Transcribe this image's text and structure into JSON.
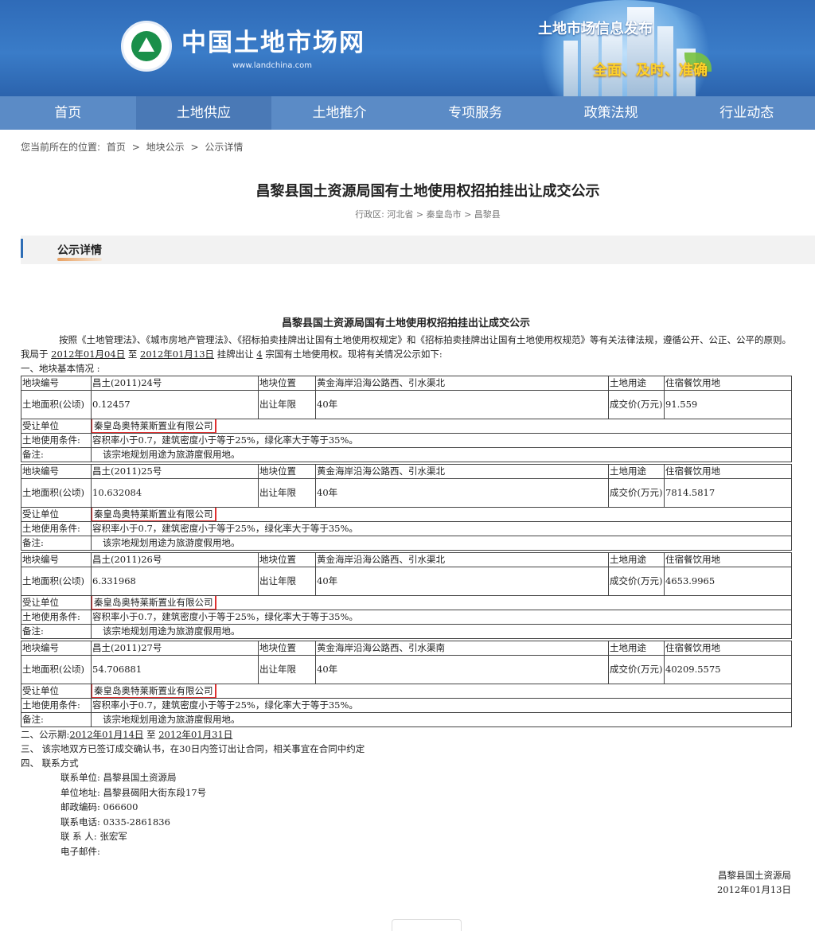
{
  "header": {
    "site_name": "中国土地市场网",
    "site_url": "www.landchina.com",
    "banner_title": "土地市场信息发布",
    "banner_slogan": "全面、及时、准确"
  },
  "nav": [
    "首页",
    "土地供应",
    "土地推介",
    "专项服务",
    "政策法规",
    "行业动态"
  ],
  "breadcrumb": {
    "prefix": "您当前所在的位置:",
    "items": [
      "首页",
      ">",
      "地块公示",
      ">",
      "公示详情"
    ]
  },
  "page_title": "昌黎县国土资源局国有土地使用权招拍挂出让成交公示",
  "region": "行政区: 河北省 > 秦皇岛市 > 昌黎县",
  "section_title": "公示详情",
  "doc": {
    "title": "昌黎县国土资源局国有土地使用权招拍挂出让成交公示",
    "intro_a": "按照《土地管理法》、《城市房地产管理法》、《招标拍卖挂牌出让国有土地使用权规定》和《招标拍卖挂牌出让国有土地使用权规范》等有关法律法规，遵循公开、公正、公平的原则。我局于",
    "date_start": "2012年01月04日",
    "to": "至",
    "date_end": "2012年01月13日",
    "intro_b": "挂牌出让",
    "count": "4",
    "intro_c": "宗国有土地使用权。现将有关情况公示如下:",
    "section1": "一、地块基本情况 :",
    "labels": {
      "id": "地块编号",
      "location": "地块位置",
      "use": "土地用途",
      "area": "土地面积(公顷)",
      "term": "出让年限",
      "price": "成交价(万元)",
      "winner": "受让单位",
      "conditions": "土地使用条件:",
      "remark": "备注:"
    },
    "plots": [
      {
        "id": "昌土(2011)24号",
        "location": "黄金海岸沿海公路西、引水渠北",
        "use": "住宿餐饮用地",
        "area": "0.12457",
        "term": "40年",
        "price": "91.559",
        "winner": "秦皇岛奥特莱斯置业有限公司",
        "conditions": "容积率小于0.7，建筑密度小于等于25%，绿化率大于等于35%。",
        "remark": "该宗地规划用途为旅游度假用地。"
      },
      {
        "id": "昌土(2011)25号",
        "location": "黄金海岸沿海公路西、引水渠北",
        "use": "住宿餐饮用地",
        "area": "10.632084",
        "term": "40年",
        "price": "7814.5817",
        "winner": "秦皇岛奥特莱斯置业有限公司",
        "conditions": "容积率小于0.7，建筑密度小于等于25%，绿化率大于等于35%。",
        "remark": "该宗地规划用途为旅游度假用地。"
      },
      {
        "id": "昌土(2011)26号",
        "location": "黄金海岸沿海公路西、引水渠北",
        "use": "住宿餐饮用地",
        "area": "6.331968",
        "term": "40年",
        "price": "4653.9965",
        "winner": "秦皇岛奥特莱斯置业有限公司",
        "conditions": "容积率小于0.7，建筑密度小于等于25%，绿化率大于等于35%。",
        "remark": "该宗地规划用途为旅游度假用地。"
      },
      {
        "id": "昌土(2011)27号",
        "location": "黄金海岸沿海公路西、引水渠南",
        "use": "住宿餐饮用地",
        "area": "54.706881",
        "term": "40年",
        "price": "40209.5575",
        "winner": "秦皇岛奥特莱斯置业有限公司",
        "conditions": "容积率小于0.7，建筑密度小于等于25%，绿化率大于等于35%。",
        "remark": "该宗地规划用途为旅游度假用地。"
      }
    ],
    "period_label": "二、公示期:",
    "period_start": "2012年01月14日",
    "period_end": "2012年01月31日",
    "section3": "三、  该宗地双方已签订成交确认书，在30日内签订出让合同，相关事宜在合同中约定",
    "section4": "四、  联系方式",
    "contacts": [
      "联系单位: 昌黎县国土资源局",
      "单位地址: 昌黎县碣阳大街东段17号",
      "邮政编码: 066600",
      "联系电话: 0335-2861836",
      "联 系 人: 张宏军",
      "电子邮件:"
    ],
    "sign_org": "昌黎县国土资源局",
    "sign_date": "2012年01月13日"
  }
}
